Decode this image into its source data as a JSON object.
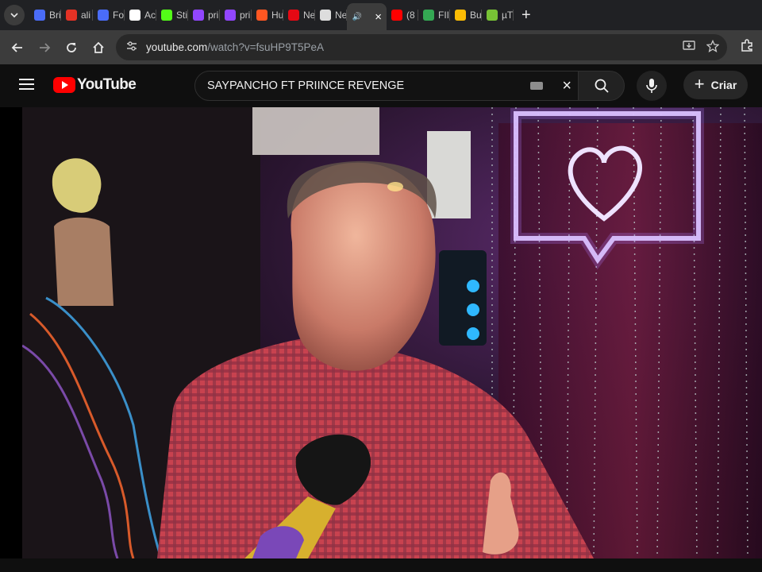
{
  "browser": {
    "tabs": [
      {
        "label": "Bri",
        "icon": "settings-wheel-icon",
        "color": "#4a6cf7"
      },
      {
        "label": "ali",
        "icon": "cart-icon",
        "color": "#e43225"
      },
      {
        "label": "Fo",
        "icon": "settings-wheel-icon",
        "color": "#4a6cf7"
      },
      {
        "label": "Ac",
        "icon": "fn-icon",
        "color": "#ffffff"
      },
      {
        "label": "Sti",
        "icon": "kick-icon",
        "color": "#53fc18"
      },
      {
        "label": "pri",
        "icon": "twitch-icon",
        "color": "#9146ff"
      },
      {
        "label": "pri",
        "icon": "twitch-icon",
        "color": "#9146ff"
      },
      {
        "label": "Hu",
        "icon": "blogger-icon",
        "color": "#ff5722"
      },
      {
        "label": "Ne",
        "icon": "netflix-icon",
        "color": "#e50914"
      },
      {
        "label": "Ne",
        "icon": "chrome-icon",
        "color": "#dddddd"
      },
      {
        "label": "",
        "icon": "speaker-icon",
        "color": "#e8e8e8",
        "active": true,
        "close": "×"
      },
      {
        "label": "(8",
        "icon": "youtube-icon",
        "color": "#ff0000"
      },
      {
        "label": "FII",
        "icon": "shield-icon",
        "color": "#34a853"
      },
      {
        "label": "Bu",
        "icon": "chrome-icon",
        "color": "#fbbc04"
      },
      {
        "label": "µT",
        "icon": "utorrent-icon",
        "color": "#78c335"
      }
    ],
    "new_tab": "+",
    "url_host": "youtube.com",
    "url_path": "/watch?v=fsuHP9T5PeA"
  },
  "youtube": {
    "logo_text": "YouTube",
    "search_value": "SAYPANCHO FT PRIINCE REVENGE",
    "clear_label": "×",
    "create_label": "Criar"
  },
  "colors": {
    "accent": "#ff0000",
    "background": "#0f0f0f"
  }
}
